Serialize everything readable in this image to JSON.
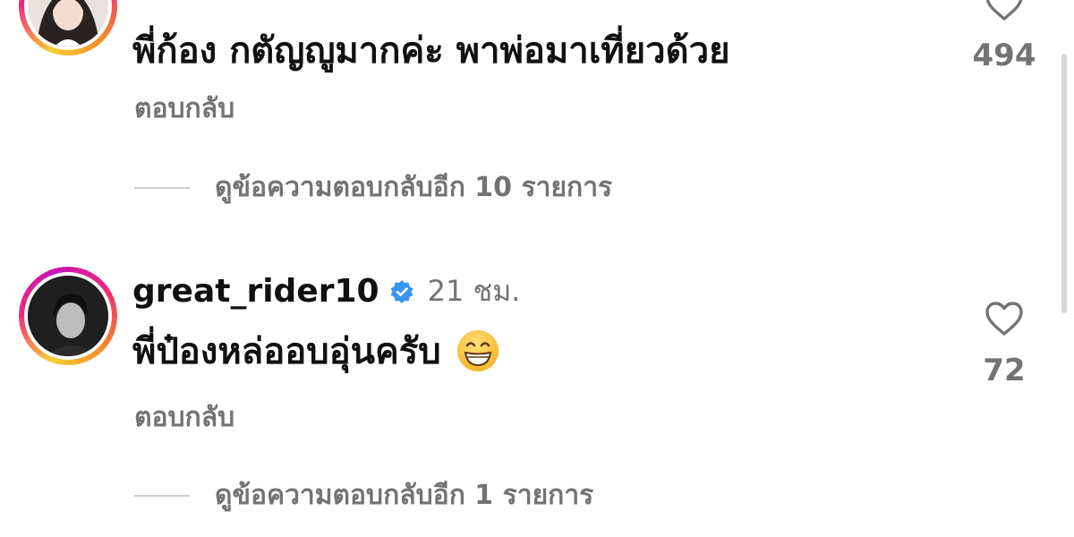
{
  "comments": [
    {
      "username": "",
      "timestamp": "",
      "text": "พี่ก้อง กตัญญูมากค่ะ พาพ่อมาเที่ยวด้วย",
      "reply_label": "ตอบกลับ",
      "view_replies": "ดูข้อความตอบกลับอีก 10 รายการ",
      "likes": "494",
      "verified": false,
      "avatar_icon": "avatar-woman"
    },
    {
      "username": "great_rider10",
      "timestamp": "21 ชม.",
      "text": "พี่ป๋องหล่ออบอุ่นครับ",
      "emoji": "grinning-face-emoji",
      "reply_label": "ตอบกลับ",
      "view_replies": "ดูข้อความตอบกลับอีก 1 รายการ",
      "likes": "72",
      "verified": true,
      "avatar_icon": "avatar-man"
    }
  ],
  "colors": {
    "text_primary": "#111111",
    "text_secondary": "#737373",
    "verified_blue": "#3897f0",
    "story_ring_start": "#f9ce34",
    "story_ring_end": "#ee2a7b"
  }
}
